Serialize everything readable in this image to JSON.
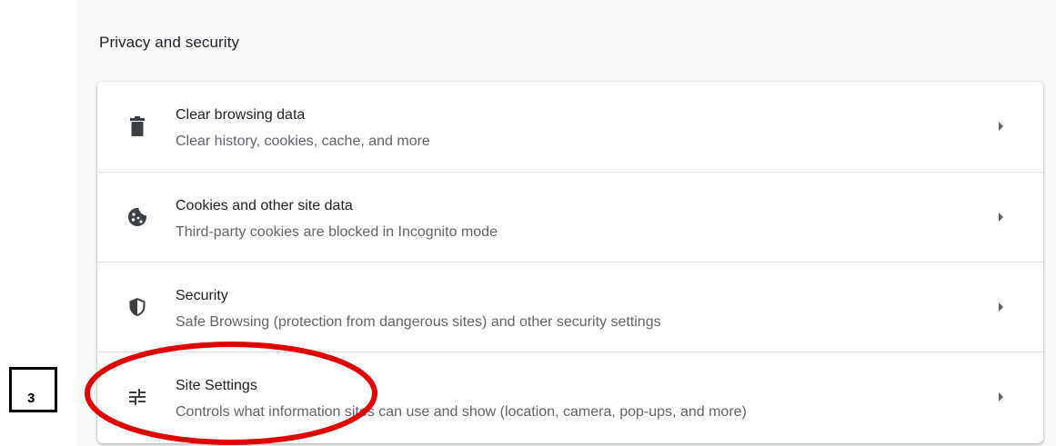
{
  "section": {
    "title": "Privacy and security"
  },
  "items": [
    {
      "title": "Clear browsing data",
      "subtitle": "Clear history, cookies, cache, and more",
      "icon": "trash-icon"
    },
    {
      "title": "Cookies and other site data",
      "subtitle": "Third-party cookies are blocked in Incognito mode",
      "icon": "cookie-icon"
    },
    {
      "title": "Security",
      "subtitle": "Safe Browsing (protection from dangerous sites) and other security settings",
      "icon": "shield-icon"
    },
    {
      "title": "Site Settings",
      "subtitle": "Controls what information sites can use and show (location, camera, pop-ups, and more)",
      "icon": "tune-icon"
    }
  ],
  "annotation": {
    "step_label": "3",
    "highlight_color": "#e00000"
  },
  "colors": {
    "icon": "#3c4043",
    "arrow": "#5f6368",
    "background": "#f8f9fa"
  }
}
